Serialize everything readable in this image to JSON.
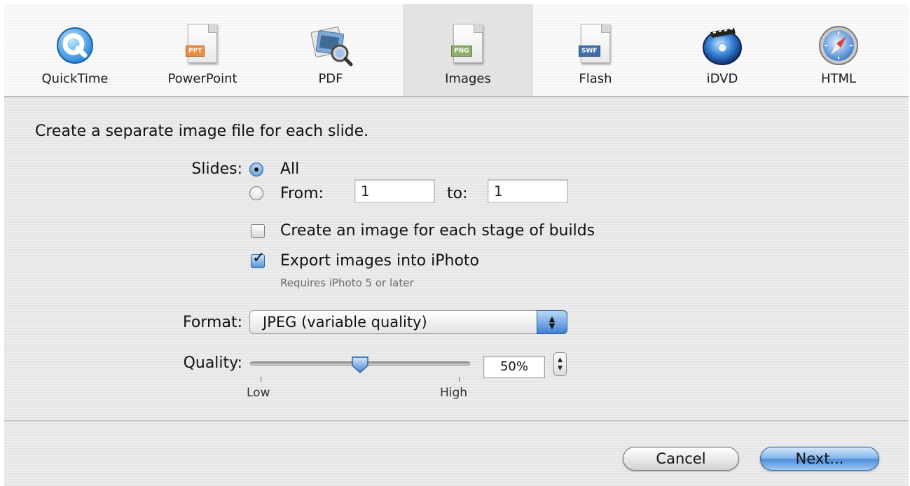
{
  "toolbar": {
    "tabs": [
      {
        "label": "QuickTime",
        "icon": "quicktime-icon"
      },
      {
        "label": "PowerPoint",
        "icon": "powerpoint-document-icon",
        "badge": "PPT"
      },
      {
        "label": "PDF",
        "icon": "pdf-preview-icon"
      },
      {
        "label": "Images",
        "icon": "png-document-icon",
        "badge": "PNG"
      },
      {
        "label": "Flash",
        "icon": "swf-document-icon",
        "badge": "SWF"
      },
      {
        "label": "iDVD",
        "icon": "idvd-disc-icon"
      },
      {
        "label": "HTML",
        "icon": "safari-compass-icon"
      }
    ],
    "selected": "Images"
  },
  "main": {
    "description": "Create a separate image file for each slide.",
    "slides": {
      "label": "Slides:",
      "all_label": "All",
      "from_label": "From:",
      "from_value": "1",
      "to_label": "to:",
      "to_value": "1",
      "selected": "All"
    },
    "builds_checkbox": {
      "label": "Create an image for each stage of builds",
      "checked": false
    },
    "iphoto_checkbox": {
      "label": "Export images into iPhoto",
      "checked": true,
      "note": "Requires iPhoto 5 or later"
    },
    "format": {
      "label": "Format:",
      "value": "JPEG (variable quality)"
    },
    "quality": {
      "label": "Quality:",
      "low_label": "Low",
      "high_label": "High",
      "value": "50%",
      "fraction": 0.5
    }
  },
  "buttons": {
    "cancel": "Cancel",
    "next": "Next..."
  },
  "colors": {
    "accent": "#4a8ad8",
    "ppt_badge": "#f08a3c",
    "png_badge": "#8fae6a",
    "swf_badge": "#3e6fa8"
  }
}
